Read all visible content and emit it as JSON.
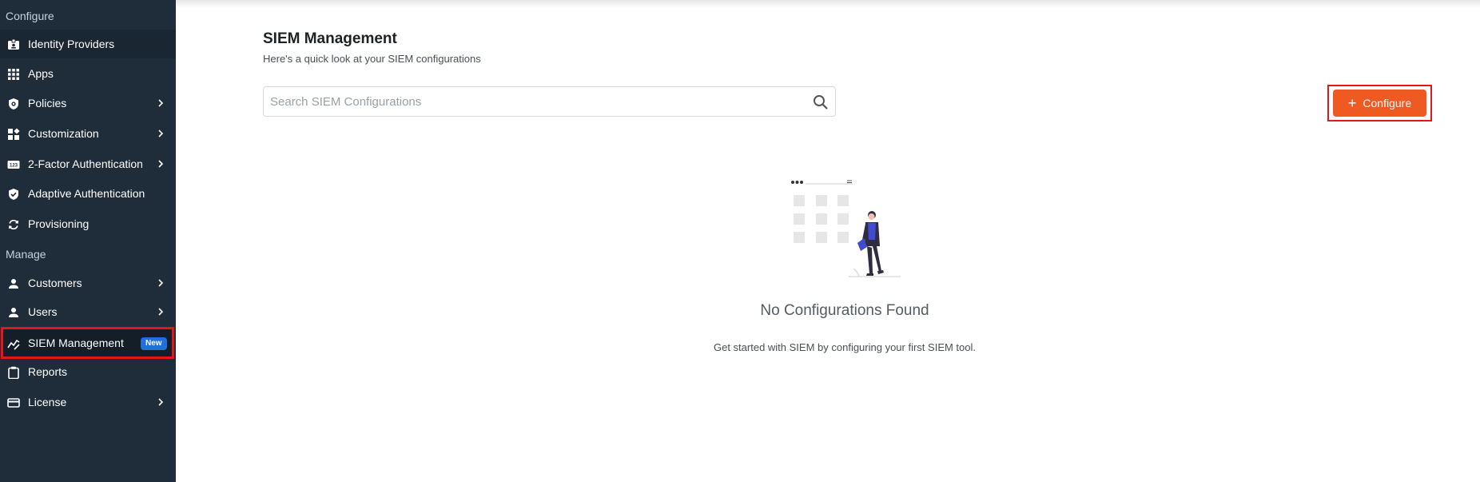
{
  "sidebar": {
    "sections": [
      {
        "label": "Configure"
      },
      {
        "label": "Manage"
      }
    ],
    "items": [
      {
        "label": "Identity Providers",
        "icon": "badge-icon"
      },
      {
        "label": "Apps",
        "icon": "grid-icon"
      },
      {
        "label": "Policies",
        "icon": "shield-gear-icon"
      },
      {
        "label": "Customization",
        "icon": "widgets-icon"
      },
      {
        "label": "2-Factor Authentication",
        "icon": "123-icon"
      },
      {
        "label": "Adaptive Authentication",
        "icon": "shield-check-icon"
      },
      {
        "label": "Provisioning",
        "icon": "sync-icon"
      },
      {
        "label": "Customers",
        "icon": "person-icon"
      },
      {
        "label": "Users",
        "icon": "person-icon"
      },
      {
        "label": "SIEM Management",
        "icon": "chart-line-icon",
        "badge": "New"
      },
      {
        "label": "Reports",
        "icon": "clipboard-icon"
      },
      {
        "label": "License",
        "icon": "card-icon"
      }
    ]
  },
  "main": {
    "title": "SIEM Management",
    "subtitle": "Here's a quick look at your SIEM configurations",
    "search_placeholder": "Search SIEM Configurations",
    "configure_label": "Configure",
    "empty_title": "No Configurations Found",
    "empty_subtitle": "Get started with SIEM by configuring your first SIEM tool."
  },
  "colors": {
    "sidebar_bg": "#1f2d3a",
    "accent": "#ef5a22",
    "badge": "#1f6fdd",
    "highlight_outline": "#e01818"
  }
}
